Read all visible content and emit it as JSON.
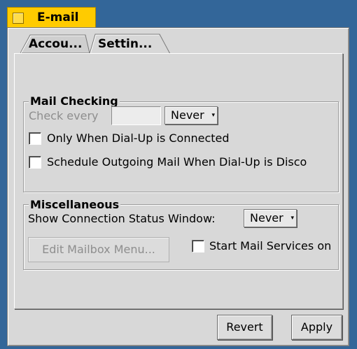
{
  "window": {
    "title": "E-mail"
  },
  "tabs": [
    {
      "label": "Accou...",
      "active": false
    },
    {
      "label": "Settin...",
      "active": true
    }
  ],
  "mail_checking": {
    "group_label": "Mail Checking",
    "check_every_label": "Check every",
    "check_every_value": "",
    "interval_menu": "Never",
    "only_dialup_label": "Only When Dial-Up is Connected",
    "only_dialup_checked": false,
    "schedule_outgoing_label": "Schedule Outgoing Mail When Dial-Up is Disco",
    "schedule_outgoing_checked": false
  },
  "miscellaneous": {
    "group_label": "Miscellaneous",
    "status_window_label": "Show Connection Status Window:",
    "status_window_menu": "Never",
    "edit_mailbox_button": "Edit Mailbox Menu...",
    "start_services_label": "Start Mail Services on",
    "start_services_checked": false
  },
  "buttons": {
    "revert": "Revert",
    "apply": "Apply"
  },
  "colors": {
    "desktop": "#336699",
    "title_tab": "#ffcb00",
    "panel": "#d8d8d8"
  }
}
